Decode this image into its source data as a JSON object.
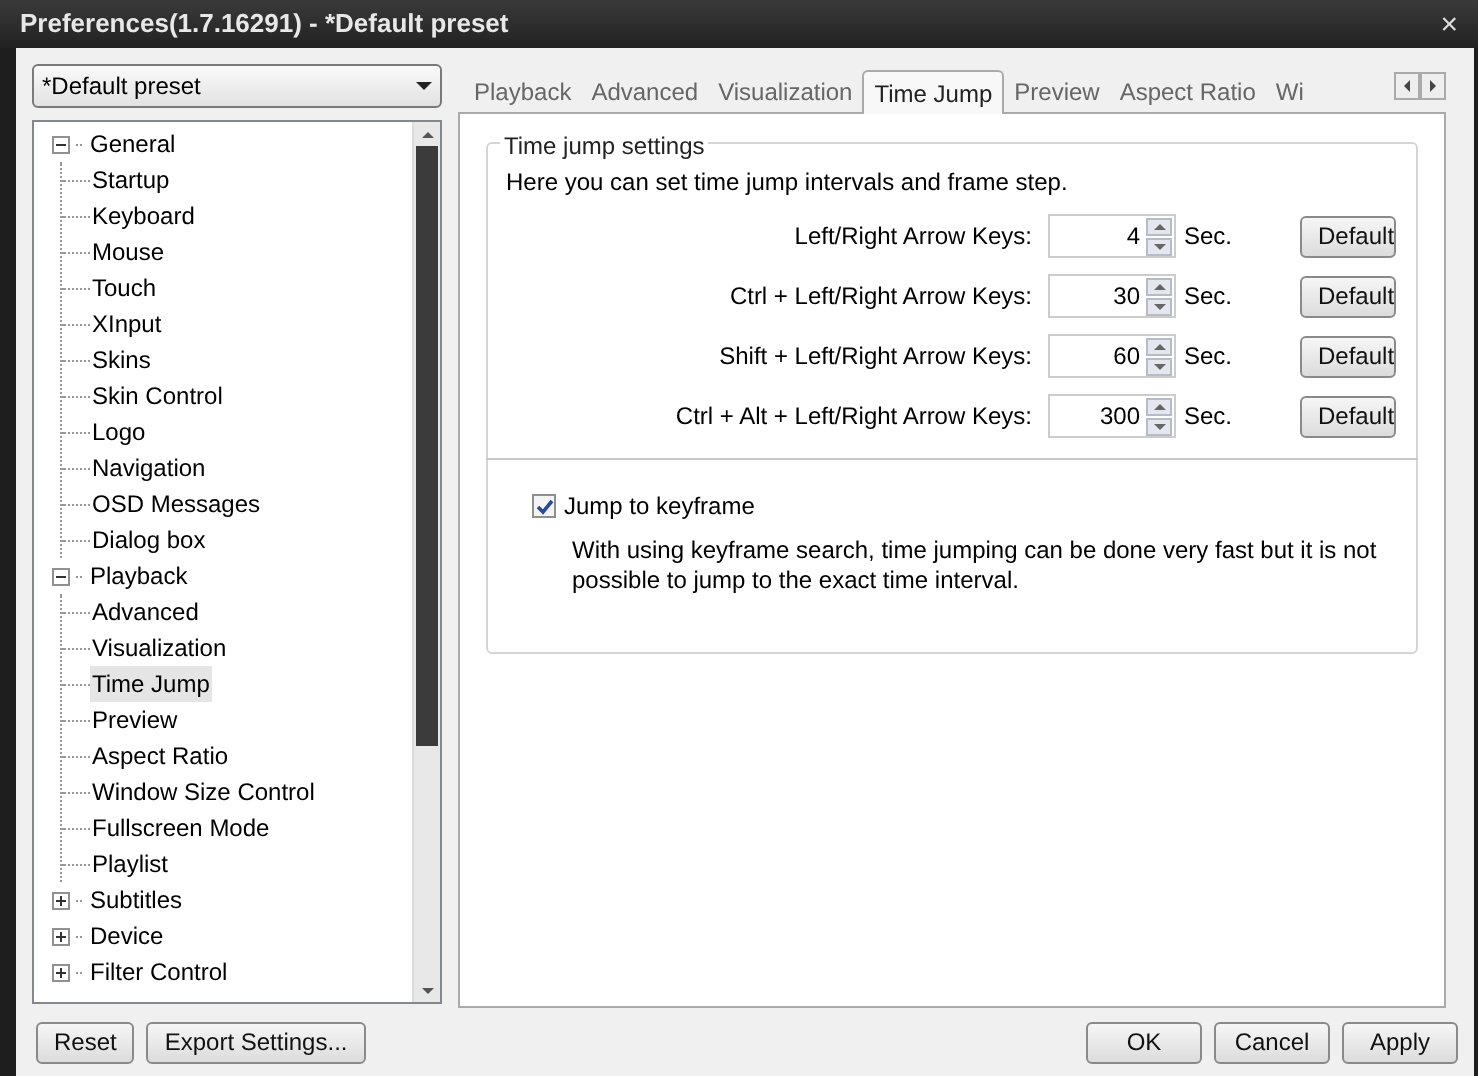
{
  "window": {
    "title": "Preferences(1.7.16291) - *Default preset",
    "close": "×"
  },
  "preset": {
    "value": "*Default preset"
  },
  "tree": [
    {
      "label": "General",
      "expanded": true,
      "selected": false,
      "children": [
        {
          "label": "Startup",
          "selected": false
        },
        {
          "label": "Keyboard",
          "selected": false
        },
        {
          "label": "Mouse",
          "selected": false
        },
        {
          "label": "Touch",
          "selected": false
        },
        {
          "label": "XInput",
          "selected": false
        },
        {
          "label": "Skins",
          "selected": false
        },
        {
          "label": "Skin Control",
          "selected": false
        },
        {
          "label": "Logo",
          "selected": false
        },
        {
          "label": "Navigation",
          "selected": false
        },
        {
          "label": "OSD Messages",
          "selected": false
        },
        {
          "label": "Dialog box",
          "selected": false
        }
      ]
    },
    {
      "label": "Playback",
      "expanded": true,
      "selected": false,
      "children": [
        {
          "label": "Advanced",
          "selected": false
        },
        {
          "label": "Visualization",
          "selected": false
        },
        {
          "label": "Time Jump",
          "selected": true
        },
        {
          "label": "Preview",
          "selected": false
        },
        {
          "label": "Aspect Ratio",
          "selected": false
        },
        {
          "label": "Window Size Control",
          "selected": false
        },
        {
          "label": "Fullscreen Mode",
          "selected": false
        },
        {
          "label": "Playlist",
          "selected": false
        }
      ]
    },
    {
      "label": "Subtitles",
      "expanded": false,
      "selected": false
    },
    {
      "label": "Device",
      "expanded": false,
      "selected": false
    },
    {
      "label": "Filter Control",
      "expanded": false,
      "selected": false
    }
  ],
  "tabs": [
    {
      "label": "Playback",
      "selected": false
    },
    {
      "label": "Advanced",
      "selected": false
    },
    {
      "label": "Visualization",
      "selected": false
    },
    {
      "label": "Time Jump",
      "selected": true
    },
    {
      "label": "Preview",
      "selected": false
    },
    {
      "label": "Aspect Ratio",
      "selected": false
    },
    {
      "label": "Wi",
      "selected": false
    }
  ],
  "group": {
    "title": "Time jump settings",
    "intro": "Here you can set time jump intervals and frame step.",
    "rows": [
      {
        "label": "Left/Right Arrow Keys:",
        "value": "4",
        "unit": "Sec.",
        "button": "Default"
      },
      {
        "label": "Ctrl + Left/Right Arrow Keys:",
        "value": "30",
        "unit": "Sec.",
        "button": "Default"
      },
      {
        "label": "Shift + Left/Right Arrow Keys:",
        "value": "60",
        "unit": "Sec.",
        "button": "Default"
      },
      {
        "label": "Ctrl + Alt + Left/Right Arrow Keys:",
        "value": "300",
        "unit": "Sec.",
        "button": "Default"
      }
    ],
    "keyframe": {
      "label": "Jump to keyframe",
      "checked": true,
      "note": "With using keyframe search, time jumping can be done very fast but it is not possible to jump to the exact time interval."
    }
  },
  "buttons_left": [
    "Reset",
    "Export Settings..."
  ],
  "buttons_right": [
    "OK",
    "Cancel",
    "Apply"
  ]
}
